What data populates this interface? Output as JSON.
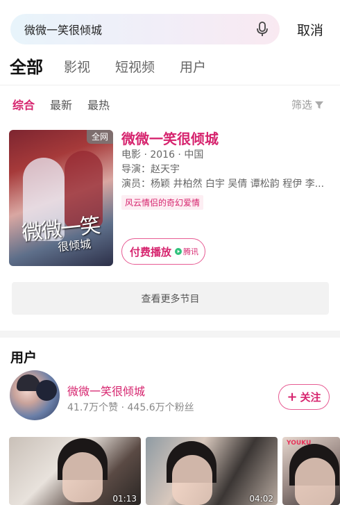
{
  "search": {
    "query": "微微一笑很倾城",
    "cancel_label": "取消"
  },
  "tabs": [
    "全部",
    "影视",
    "短视频",
    "用户"
  ],
  "active_tab": "全部",
  "subfilters": [
    "综合",
    "最新",
    "最热"
  ],
  "filter_label": "筛选",
  "result": {
    "badge": "全网",
    "poster_title": "微微一笑",
    "poster_subtitle": "很倾城",
    "title": "微微一笑很倾城",
    "meta": "电影 · 2016 · 中国",
    "director": "导演：赵天宇",
    "cast": "演员：杨颖 井柏然 白宇 吴倩 谭松韵 程伊 李...",
    "tag": "风云情侣的奇幻爱情",
    "play_label": "付费播放",
    "play_provider": "腾讯"
  },
  "more_label": "查看更多节目",
  "users": {
    "heading": "用户",
    "name": "微微一笑很倾城",
    "stats": "41.7万个赞 · 445.6万个粉丝",
    "follow_label": "关注"
  },
  "videos": [
    {
      "duration": "01:13"
    },
    {
      "duration": "04:02"
    },
    {
      "source": "YOUKU"
    }
  ],
  "colors": {
    "accent": "#d6246e",
    "tag_bg": "#fdeef3",
    "more_bg": "#f2f2f2"
  },
  "icons": [
    "mic-icon",
    "filter-icon",
    "play-provider-icon",
    "plus-icon"
  ]
}
